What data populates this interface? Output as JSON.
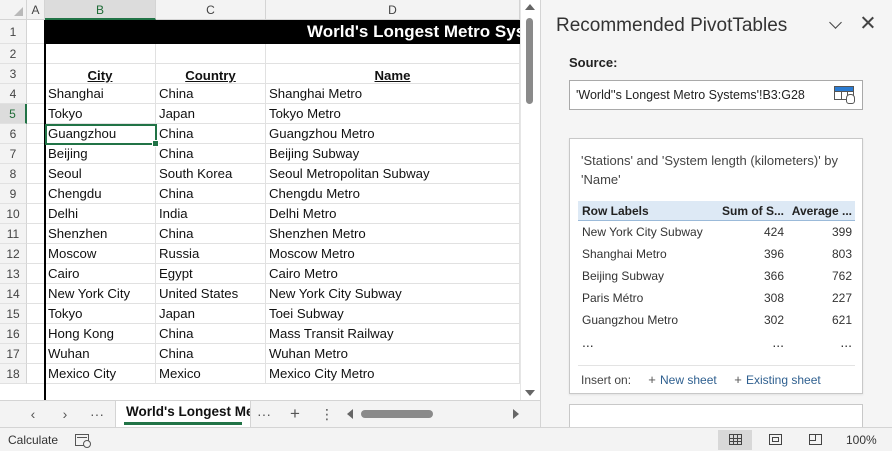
{
  "spreadsheet": {
    "column_headers": [
      "A",
      "B",
      "C",
      "D"
    ],
    "row_numbers": [
      "1",
      "2",
      "3",
      "4",
      "5",
      "6",
      "7",
      "8",
      "9",
      "10",
      "11",
      "12",
      "13",
      "14",
      "15",
      "16",
      "17",
      "18"
    ],
    "title_text": "World's Longest Metro Sys",
    "table_headers": {
      "city": "City",
      "country": "Country",
      "name": "Name"
    },
    "rows": [
      {
        "city": "Shanghai",
        "country": "China",
        "name": "Shanghai Metro"
      },
      {
        "city": "Tokyo",
        "country": "Japan",
        "name": "Tokyo Metro"
      },
      {
        "city": "Guangzhou",
        "country": "China",
        "name": "Guangzhou Metro"
      },
      {
        "city": "Beijing",
        "country": "China",
        "name": "Beijing Subway"
      },
      {
        "city": "Seoul",
        "country": "South Korea",
        "name": "Seoul Metropolitan Subway"
      },
      {
        "city": "Chengdu",
        "country": "China",
        "name": "Chengdu Metro"
      },
      {
        "city": "Delhi",
        "country": "India",
        "name": "Delhi Metro"
      },
      {
        "city": "Shenzhen",
        "country": "China",
        "name": "Shenzhen Metro"
      },
      {
        "city": "Moscow",
        "country": "Russia",
        "name": "Moscow Metro"
      },
      {
        "city": "Cairo",
        "country": "Egypt",
        "name": "Cairo Metro"
      },
      {
        "city": "New York City",
        "country": "United States",
        "name": "New York City Subway"
      },
      {
        "city": "Tokyo",
        "country": "Japan",
        "name": "Toei Subway"
      },
      {
        "city": "Hong Kong",
        "country": "China",
        "name": "Mass Transit Railway"
      },
      {
        "city": "Wuhan",
        "country": "China",
        "name": "Wuhan Metro"
      },
      {
        "city": "Mexico City",
        "country": "Mexico",
        "name": "Mexico City Metro"
      }
    ],
    "selected_cell": "B5"
  },
  "tabbar": {
    "prev_label": "‹",
    "next_label": "›",
    "more_label": "···",
    "sheet_name": "World's Longest Metro Systems",
    "more_sheets_label": "···",
    "add_sheet_label": "+",
    "options_label": "⋮"
  },
  "statusbar": {
    "status": "Calculate",
    "zoom": "100%"
  },
  "pane": {
    "title": "Recommended PivotTables",
    "source_label": "Source:",
    "source_value": "'World''s Longest Metro Systems'!B3:G28",
    "card": {
      "description": "'Stations' and 'System length (kilometers)' by 'Name'",
      "headers": [
        "Row Labels",
        "Sum of S...",
        "Average ..."
      ],
      "rows": [
        [
          "New York City Subway",
          "424",
          "399"
        ],
        [
          "Shanghai Metro",
          "396",
          "803"
        ],
        [
          "Beijing Subway",
          "366",
          "762"
        ],
        [
          "Paris Métro",
          "308",
          "227"
        ],
        [
          "Guangzhou Metro",
          "302",
          "621"
        ]
      ],
      "ellipsis": [
        "...",
        "...",
        "..."
      ],
      "insert_label": "Insert on:",
      "new_sheet": "New sheet",
      "existing_sheet": "Existing sheet"
    }
  },
  "colors": {
    "accent": "#217346",
    "pivot_header_bg": "#dde9f5"
  },
  "icons": [
    "chevron-down-icon",
    "close-icon",
    "range-picker-icon",
    "plus-icon",
    "normal-view-icon",
    "page-layout-icon",
    "page-break-icon",
    "macro-record-icon"
  ]
}
